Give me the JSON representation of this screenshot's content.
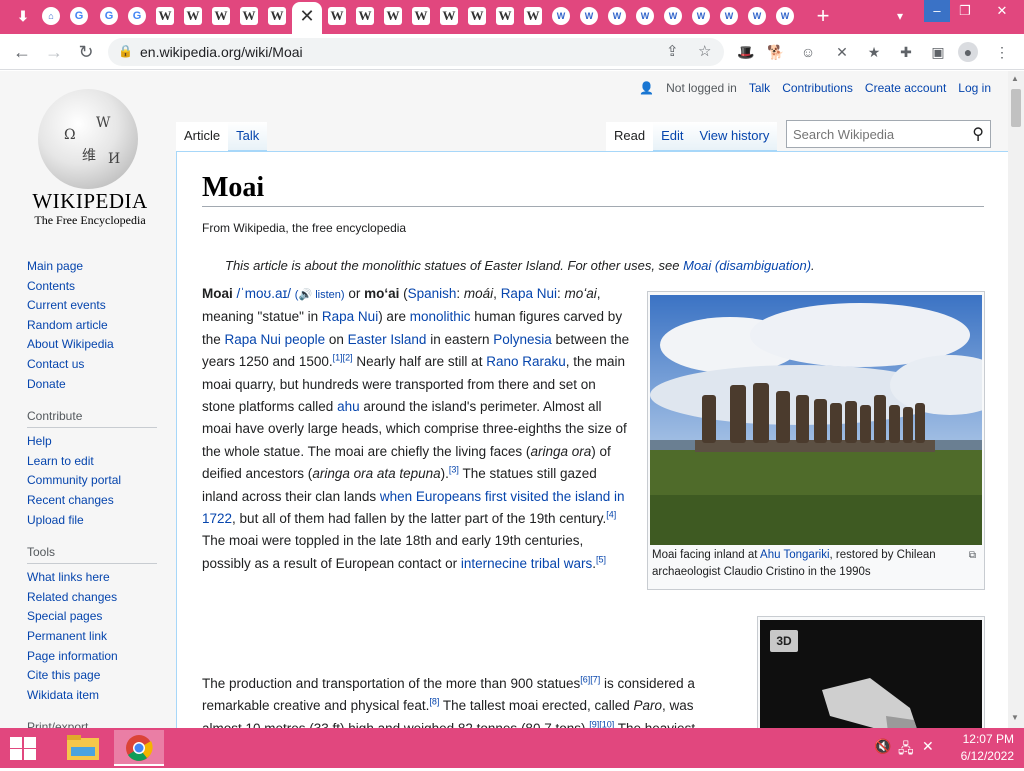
{
  "browser": {
    "active_tab_close": "✕",
    "new_tab": "+",
    "url": "en.wikipedia.org/wiki/Moai"
  },
  "personal": {
    "not_logged_in": "Not logged in",
    "talk": "Talk",
    "contributions": "Contributions",
    "create_account": "Create account",
    "log_in": "Log in"
  },
  "logo": {
    "wordmark": "WIKIPEDIA",
    "tagline": "The Free Encyclopedia"
  },
  "sidebar": {
    "main": [
      "Main page",
      "Contents",
      "Current events",
      "Random article",
      "About Wikipedia",
      "Contact us",
      "Donate"
    ],
    "contribute_heading": "Contribute",
    "contribute": [
      "Help",
      "Learn to edit",
      "Community portal",
      "Recent changes",
      "Upload file"
    ],
    "tools_heading": "Tools",
    "tools": [
      "What links here",
      "Related changes",
      "Special pages",
      "Permanent link",
      "Page information",
      "Cite this page",
      "Wikidata item"
    ],
    "print_heading": "Print/export"
  },
  "page_tabs": {
    "article": "Article",
    "talk": "Talk",
    "read": "Read",
    "edit": "Edit",
    "history": "View history"
  },
  "search": {
    "placeholder": "Search Wikipedia"
  },
  "article": {
    "title": "Moai",
    "from": "From Wikipedia, the free encyclopedia",
    "hatnote_text": "This article is about the monolithic statues of Easter Island. For other uses, see ",
    "hatnote_link": "Moai (disambiguation)",
    "hatnote_end": ".",
    "image_caption_1": "Moai facing inland at ",
    "image_caption_link": "Ahu Tongariki",
    "image_caption_2": ", restored by Chilean archaeologist Claudio Cristino in the 1990s",
    "badge_3d": "3D"
  },
  "taskbar": {
    "time": "12:07 PM",
    "date": "6/12/2022"
  }
}
